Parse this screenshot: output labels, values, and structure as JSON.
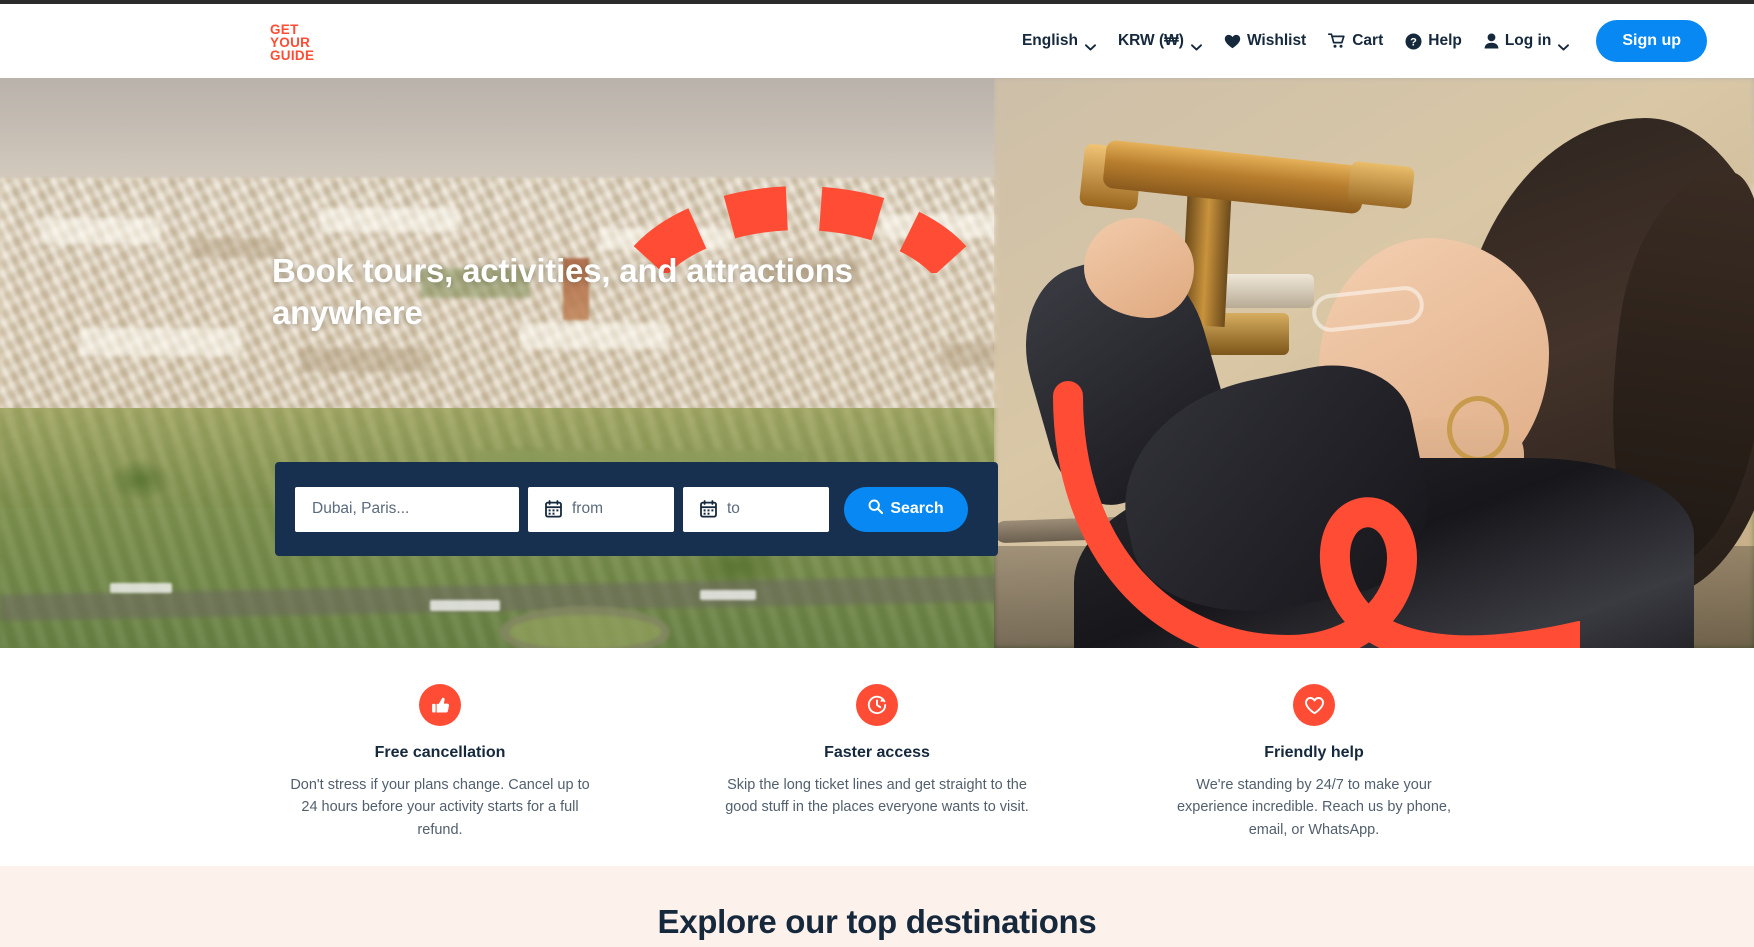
{
  "brand": {
    "name": "GetYourGuide",
    "logo_lines": [
      "GET",
      "YOUR",
      "GUIDE"
    ],
    "accent_color": "#ff4d35",
    "blue": "#0888f2",
    "navy": "#17304f"
  },
  "header": {
    "nav": [
      {
        "label": "English",
        "icon": "none",
        "caret": true
      },
      {
        "label": "KRW (₩)",
        "icon": "none",
        "caret": true
      },
      {
        "label": "Wishlist",
        "icon": "heart-icon",
        "caret": false
      },
      {
        "label": "Cart",
        "icon": "cart-icon",
        "caret": false
      },
      {
        "label": "Help",
        "icon": "question-circle-icon",
        "caret": false
      },
      {
        "label": "Log in",
        "icon": "user-icon",
        "caret": true
      }
    ],
    "signup_label": "Sign up"
  },
  "hero": {
    "heading": "Book tours, activities, and attractions anywhere",
    "search": {
      "destination_placeholder": "Dubai, Paris...",
      "destination_value": "",
      "from_placeholder": "from",
      "from_value": "",
      "to_placeholder": "to",
      "to_value": "",
      "search_label": "Search",
      "search_icon": "magnifier-icon",
      "date_icon": "calendar-icon"
    }
  },
  "features": [
    {
      "icon": "thumbs-up-icon",
      "title": "Free cancellation",
      "desc": "Don't stress if your plans change. Cancel up to 24 hours before your activity starts for a full refund."
    },
    {
      "icon": "clock-icon",
      "title": "Faster access",
      "desc": "Skip the long ticket lines and get straight to the good stuff in the places everyone wants to visit."
    },
    {
      "icon": "heart-outline-icon",
      "title": "Friendly help",
      "desc": "We're standing by 24/7 to make your experience incredible. Reach us by phone, email, or WhatsApp."
    }
  ],
  "destinations": {
    "title": "Explore our top destinations"
  }
}
